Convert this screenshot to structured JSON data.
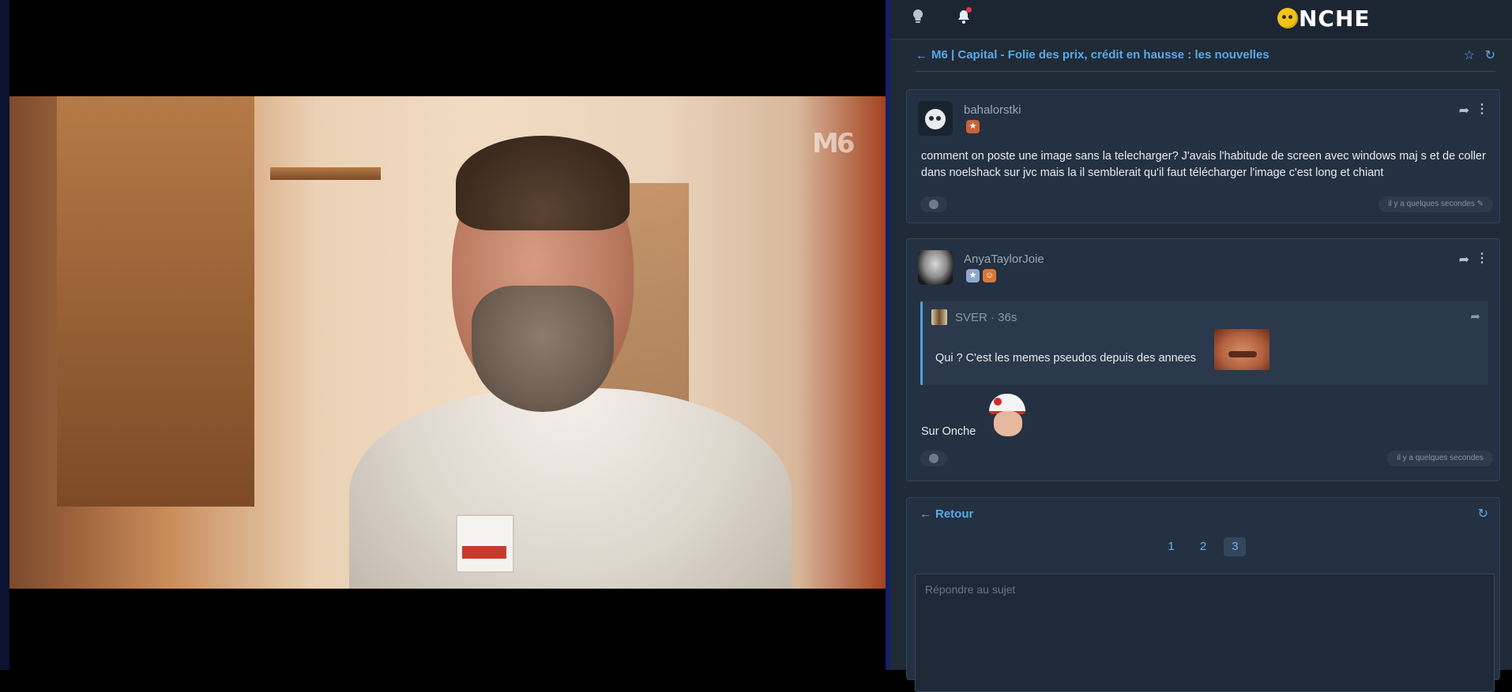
{
  "video": {
    "channel_logo": "M6"
  },
  "topbar": {
    "icons": [
      "lightbulb-icon",
      "bell-icon"
    ],
    "logo_text": "NCHE",
    "colors": {
      "accent": "#5aa9e6",
      "logo_face": "#f0c419",
      "notif_dot": "#e3354b"
    }
  },
  "topic": {
    "title": "M6 | Capital - Folie des prix, crédit en hausse : les nouvelles",
    "back_icon": "arrow-left-icon",
    "favorite_icon": "star-icon",
    "refresh_icon": "refresh-icon"
  },
  "posts": [
    {
      "author": "bahalorstki",
      "badges": [
        "bronze-star"
      ],
      "text": "comment on poste une image sans la telecharger? J'avais l'habitude de screen avec windows maj s et de coller dans noelshack sur jvc mais la il semblerait qu'il faut télécharger l'image c'est long et chiant",
      "timestamp": "il y a quelques secondes",
      "edit_icon": "pencil-icon"
    },
    {
      "author": "AnyaTaylorJoie",
      "badges": [
        "silver-star",
        "orange-face"
      ],
      "quote": {
        "author": "SVER · 36s",
        "text": "Qui ? C'est les memes pseudos depuis des annees"
      },
      "text": "Sur Onche",
      "timestamp": "il y a quelques secondes"
    }
  ],
  "footer": {
    "back_label": "Retour",
    "pages": [
      "1",
      "2",
      "3"
    ],
    "current_page": "3",
    "reply_placeholder": "Répondre au sujet"
  }
}
